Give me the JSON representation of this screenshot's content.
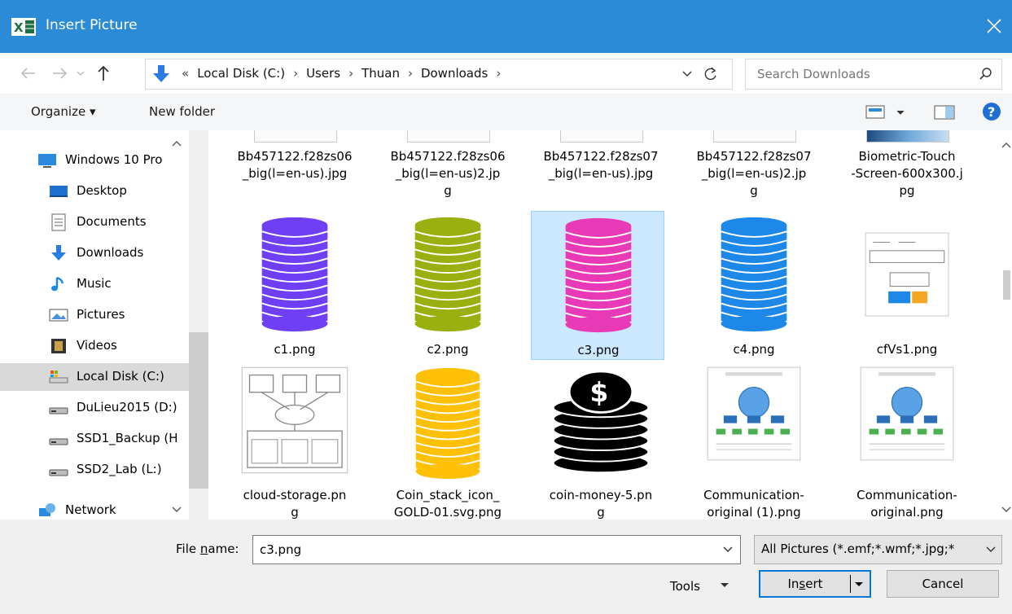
{
  "window": {
    "title": "Insert Picture",
    "app_icon": "excel-icon",
    "close_icon": "close-icon"
  },
  "address": {
    "crumbs": [
      "«",
      "Local Disk (C:)",
      "›",
      "Users",
      "›",
      "Thuan",
      "›",
      "Downloads",
      "›"
    ],
    "search_placeholder": "Search Downloads"
  },
  "toolbar": {
    "organize": "Organize ▾",
    "new_folder": "New folder"
  },
  "nav": [
    {
      "label": "Windows 10 Pro",
      "icon": "computer-icon"
    },
    {
      "label": "Desktop",
      "icon": "desktop-icon"
    },
    {
      "label": "Documents",
      "icon": "documents-icon"
    },
    {
      "label": "Downloads",
      "icon": "downloads-icon"
    },
    {
      "label": "Music",
      "icon": "music-icon"
    },
    {
      "label": "Pictures",
      "icon": "pictures-icon"
    },
    {
      "label": "Videos",
      "icon": "videos-icon"
    },
    {
      "label": "Local Disk (C:)",
      "icon": "windows-drive-icon",
      "selected": true
    },
    {
      "label": "DuLieu2015 (D:)",
      "icon": "drive-icon"
    },
    {
      "label": "SSD1_Backup (H",
      "icon": "drive-icon"
    },
    {
      "label": "SSD2_Lab (L:)",
      "icon": "drive-icon"
    },
    {
      "label": "Network",
      "icon": "network-icon"
    }
  ],
  "files_row1": [
    {
      "lines": [
        "Bb457122.f28zs06",
        "_big(l=en-us).jpg"
      ]
    },
    {
      "lines": [
        "Bb457122.f28zs06",
        "_big(l=en-us)2.jp",
        "g"
      ]
    },
    {
      "lines": [
        "Bb457122.f28zs07",
        "_big(l=en-us).jpg"
      ]
    },
    {
      "lines": [
        "Bb457122.f28zs07",
        "_big(l=en-us)2.jp",
        "g"
      ]
    },
    {
      "lines": [
        "Biometric-Touch",
        "-Screen-600x300.j",
        "pg"
      ]
    }
  ],
  "files_row2": [
    {
      "name": "c1.png",
      "color": "#6f3ff5"
    },
    {
      "name": "c2.png",
      "color": "#9aaf10"
    },
    {
      "name": "c3.png",
      "color": "#e83ab6",
      "selected": true
    },
    {
      "name": "c4.png",
      "color": "#1e88e8"
    },
    {
      "name": "cfVs1.png"
    }
  ],
  "files_row3": [
    {
      "lines": [
        "cloud-storage.pn",
        "g"
      ]
    },
    {
      "lines": [
        "Coin_stack_icon_",
        "GOLD-01.svg.png"
      ],
      "color": "#ffc107"
    },
    {
      "lines": [
        "coin-money-5.pn",
        "g"
      ]
    },
    {
      "lines": [
        "Communication-",
        "original (1).png"
      ]
    },
    {
      "lines": [
        "Communication-",
        "original.png"
      ]
    }
  ],
  "footer": {
    "file_name_label_pre": "File ",
    "file_name_label_u": "n",
    "file_name_label_post": "ame:",
    "file_name_value": "c3.png",
    "file_type": "All Pictures (*.emf;*.wmf;*.jpg;*",
    "tools": "Tools",
    "insert_pre": "In",
    "insert_u": "s",
    "insert_post": "ert",
    "cancel": "Cancel"
  }
}
